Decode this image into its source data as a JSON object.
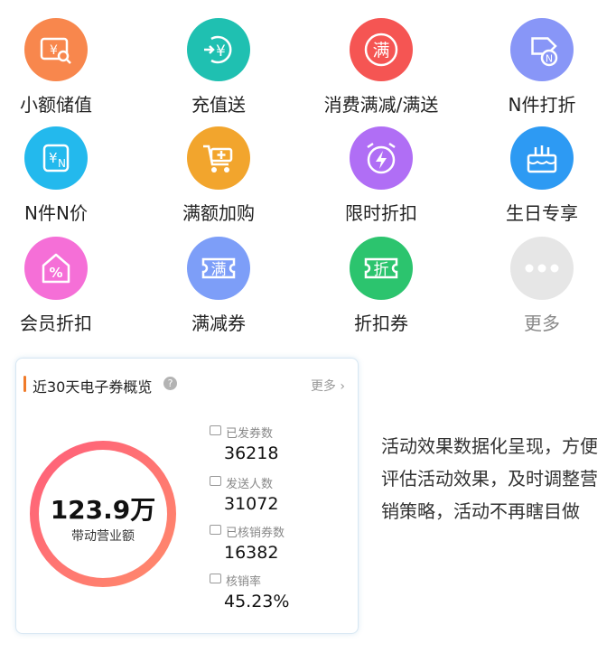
{
  "features": [
    {
      "label": "小额储值",
      "icon": "yuan-search-icon",
      "color": "#f8874d",
      "glyph": "¥"
    },
    {
      "label": "充值送",
      "icon": "recharge-yuan-icon",
      "color": "#1fc0b1",
      "glyph": "¥"
    },
    {
      "label": "消费满减/满送",
      "icon": "full-reduction-icon",
      "color": "#f55553",
      "glyph": "满"
    },
    {
      "label": "N件打折",
      "icon": "tag-n-icon",
      "color": "#8896f7",
      "glyph": "N"
    },
    {
      "label": "N件N价",
      "icon": "yuan-n-icon",
      "color": "#23b9ed",
      "glyph": "¥N"
    },
    {
      "label": "满额加购",
      "icon": "cart-plus-icon",
      "color": "#f2a52d",
      "glyph": "+"
    },
    {
      "label": "限时折扣",
      "icon": "alarm-clock-icon",
      "color": "#b06ef5",
      "glyph": "⚡"
    },
    {
      "label": "生日专享",
      "icon": "birthday-cake-icon",
      "color": "#2d9af3",
      "glyph": "🎂"
    },
    {
      "label": "会员折扣",
      "icon": "member-house-icon",
      "color": "#f56fd7",
      "glyph": "%"
    },
    {
      "label": "满减券",
      "icon": "reduction-coupon-icon",
      "color": "#7d9ef8",
      "glyph": "满"
    },
    {
      "label": "折扣券",
      "icon": "discount-coupon-icon",
      "color": "#2cc46e",
      "glyph": "折"
    },
    {
      "label": "更多",
      "icon": "more-dots-icon",
      "color": "#e6e6e6",
      "glyph": "•••"
    }
  ],
  "overview": {
    "title": "近30天电子券概览",
    "more_label": "更多",
    "ring_value": "123.9万",
    "ring_label": "带动营业额",
    "stats": [
      {
        "label": "已发券数",
        "value": "36218",
        "icon": "coupon-icon"
      },
      {
        "label": "发送人数",
        "value": "31072",
        "icon": "coupon-icon"
      },
      {
        "label": "已核销券数",
        "value": "16382",
        "icon": "check-coupon-icon"
      },
      {
        "label": "核销率",
        "value": "45.23%",
        "icon": "rate-coupon-icon"
      }
    ]
  },
  "description": "活动效果数据化呈现，方便评估活动效果，及时调整营销策略，活动不再瞎目做"
}
